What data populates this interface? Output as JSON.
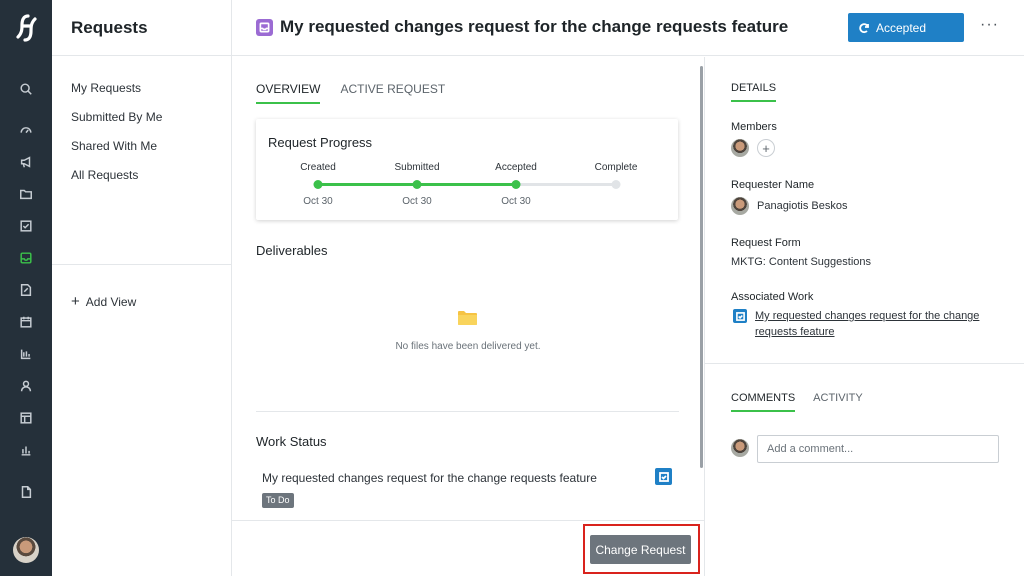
{
  "rail": {
    "icons": [
      "logo-icon",
      "search-icon",
      "dashboard-icon",
      "megaphone-icon",
      "folder-icon",
      "tasks-icon",
      "requests-icon",
      "proofs-icon",
      "calendar-icon",
      "timeline-icon",
      "people-icon",
      "layout-icon",
      "reports-icon",
      "document-icon"
    ],
    "active": "requests-icon",
    "accent": "#3bc14a",
    "background": "#25303a"
  },
  "sidebar": {
    "title": "Requests",
    "items": [
      {
        "label": "My Requests"
      },
      {
        "label": "Submitted By Me"
      },
      {
        "label": "Shared With Me"
      },
      {
        "label": "All Requests"
      }
    ],
    "add_view": "Add View"
  },
  "header": {
    "title": "My requested changes request for the change requests feature",
    "status_button": "Accepted",
    "more_label": "···",
    "status_color": "#1f80c6"
  },
  "main": {
    "tabs": [
      {
        "label": "OVERVIEW",
        "active": true
      },
      {
        "label": "ACTIVE REQUEST",
        "active": false
      }
    ],
    "progress": {
      "title": "Request Progress",
      "stages": [
        {
          "label": "Created",
          "date": "Oct 30",
          "done": true
        },
        {
          "label": "Submitted",
          "date": "Oct 30",
          "done": true
        },
        {
          "label": "Accepted",
          "date": "Oct 30",
          "done": true
        },
        {
          "label": "Complete",
          "date": "",
          "done": false
        }
      ]
    },
    "deliverables": {
      "title": "Deliverables",
      "empty_text": "No files have been delivered yet."
    },
    "work_status": {
      "title": "Work Status",
      "item": "My requested changes request for the change requests feature",
      "badge": "To Do"
    },
    "action_button": "Change Request"
  },
  "details": {
    "tab": "DETAILS",
    "members_label": "Members",
    "add_member": "+",
    "requester_label": "Requester Name",
    "requester_name": "Panagiotis Beskos",
    "form_label": "Request Form",
    "form_value": "MKTG: Content Suggestions",
    "work_label": "Associated Work",
    "work_link": "My requested changes request for the change requests feature",
    "comment_tabs": [
      {
        "label": "COMMENTS",
        "active": true
      },
      {
        "label": "ACTIVITY",
        "active": false
      }
    ],
    "comment_placeholder": "Add a comment..."
  }
}
